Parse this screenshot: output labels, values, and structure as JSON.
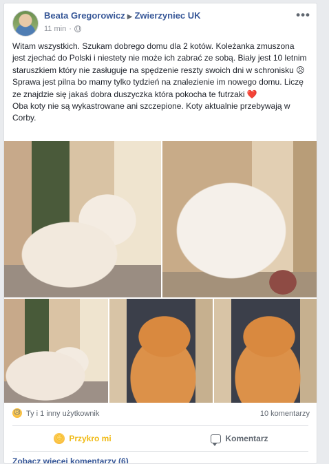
{
  "post": {
    "author": "Beata Gregorowicz",
    "group": "Zwierzyniec UK",
    "time": "11 min",
    "privacy_icon": "globe-icon",
    "more_icon": "more-horizontal-icon",
    "paragraphs": [
      "Witam wszystkich. Szukam dobrego domu dla 2 kotów. Koleżanka zmuszona jest zjechać do Polski i niestety nie może ich zabrać ze sobą. Biały jest 10 letnim staruszkiem który nie zasługuje na spędzenie reszty swoich dni w schronisku 😥 Sprawa jest pilna bo mamy tylko tydzień na znalezienie im nowego domu. Liczę ze znajdzie się jakaś dobra duszyczka która pokocha te futrzaki ❤️",
      "Oba koty nie są wykastrowane ani szczepione. Koty aktualnie przebywają w Corby."
    ]
  },
  "stats": {
    "reaction_emoji": "😥",
    "reactions_text": "Ty i 1 inny użytkownik",
    "comments_text": "10 komentarzy"
  },
  "actions": {
    "reaction_label": "Przykro mi",
    "reaction_emoji": "😥",
    "comment_label": "Komentarz"
  },
  "footer": {
    "more_comments": "Zobacz więcej komentarzy (6)"
  }
}
